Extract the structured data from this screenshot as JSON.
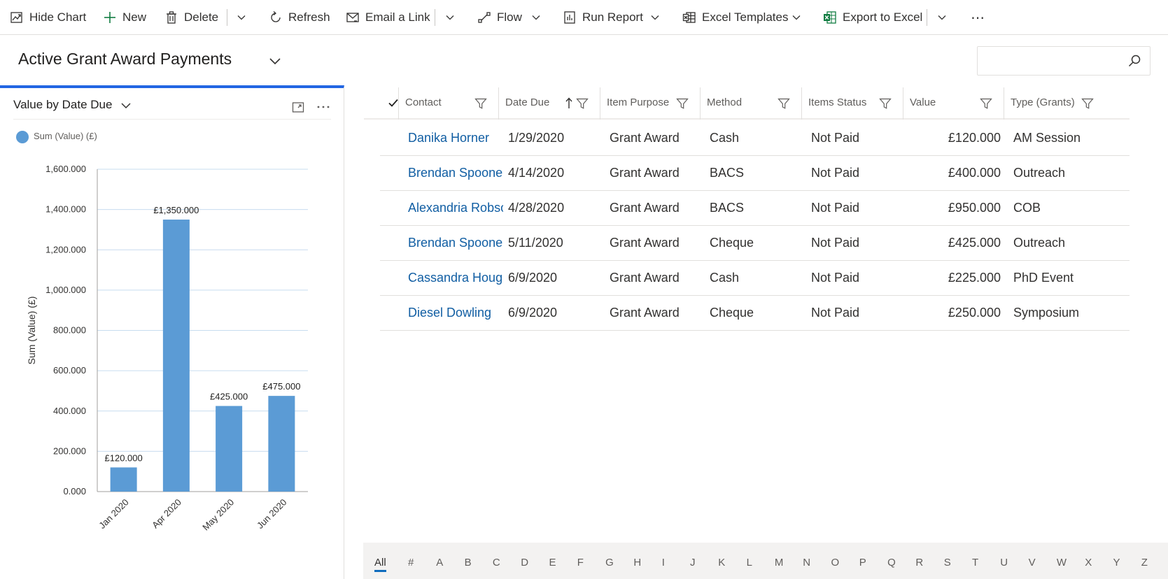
{
  "command_bar": {
    "hide_chart": "Hide Chart",
    "new": "New",
    "delete": "Delete",
    "refresh": "Refresh",
    "email_link": "Email a Link",
    "flow": "Flow",
    "run_report": "Run Report",
    "excel_templates": "Excel Templates",
    "export_excel": "Export to Excel",
    "more": "⋯"
  },
  "view": {
    "title": "Active Grant Award Payments",
    "search_placeholder": ""
  },
  "colors": {
    "accent": "#2266e3",
    "bar": "#5b9bd5",
    "link": "#115ea3",
    "excel_green": "#107c41"
  },
  "chart_data": {
    "type": "bar",
    "title": "Value by Date Due",
    "categories": [
      "Jan 2020",
      "Apr 2020",
      "May 2020",
      "Jun 2020"
    ],
    "series": [
      {
        "name": "Sum (Value) (£)",
        "values": [
          120,
          1350,
          425,
          475
        ]
      }
    ],
    "data_labels": [
      "£120.000",
      "£1,350.000",
      "£425.000",
      "£475.000"
    ],
    "y_ticks": [
      0,
      200,
      400,
      600,
      800,
      1000,
      1200,
      1400,
      1600
    ],
    "y_tick_labels": [
      "0.000",
      "200.000",
      "400.000",
      "600.000",
      "800.000",
      "1,000.000",
      "1,200.000",
      "1,400.000",
      "1,600.000"
    ],
    "xlabel": "",
    "ylabel": "Sum (Value) (£)",
    "ylim": [
      0,
      1600
    ],
    "grid": true,
    "legend": "top-left"
  },
  "grid": {
    "columns": [
      "Contact",
      "Date Due",
      "Item Purpose",
      "Method",
      "Items Status",
      "Value",
      "Type (Grants)"
    ],
    "sorted_column": "Date Due",
    "sort_direction": "ascending",
    "rows": [
      [
        "Danika Horner",
        "1/29/2020",
        "Grant Award",
        "Cash",
        "Not Paid",
        "£120.000",
        "AM Session"
      ],
      [
        "Brendan Spooner.",
        "4/14/2020",
        "Grant Award",
        "BACS",
        "Not Paid",
        "£400.000",
        "Outreach"
      ],
      [
        "Alexandria Robsor",
        "4/28/2020",
        "Grant Award",
        "BACS",
        "Not Paid",
        "£950.000",
        "COB"
      ],
      [
        "Brendan Spooner.",
        "5/11/2020",
        "Grant Award",
        "Cheque",
        "Not Paid",
        "£425.000",
        "Outreach"
      ],
      [
        "Cassandra Hough.",
        "6/9/2020",
        "Grant Award",
        "Cash",
        "Not Paid",
        "£225.000",
        "PhD Event"
      ],
      [
        "Diesel Dowling",
        "6/9/2020",
        "Grant Award",
        "Cheque",
        "Not Paid",
        "£250.000",
        "Symposium"
      ]
    ]
  },
  "jump_bar": {
    "active": "All",
    "items": [
      "All",
      "#",
      "A",
      "B",
      "C",
      "D",
      "E",
      "F",
      "G",
      "H",
      "I",
      "J",
      "K",
      "L",
      "M",
      "N",
      "O",
      "P",
      "Q",
      "R",
      "S",
      "T",
      "U",
      "V",
      "W",
      "X",
      "Y",
      "Z"
    ]
  }
}
